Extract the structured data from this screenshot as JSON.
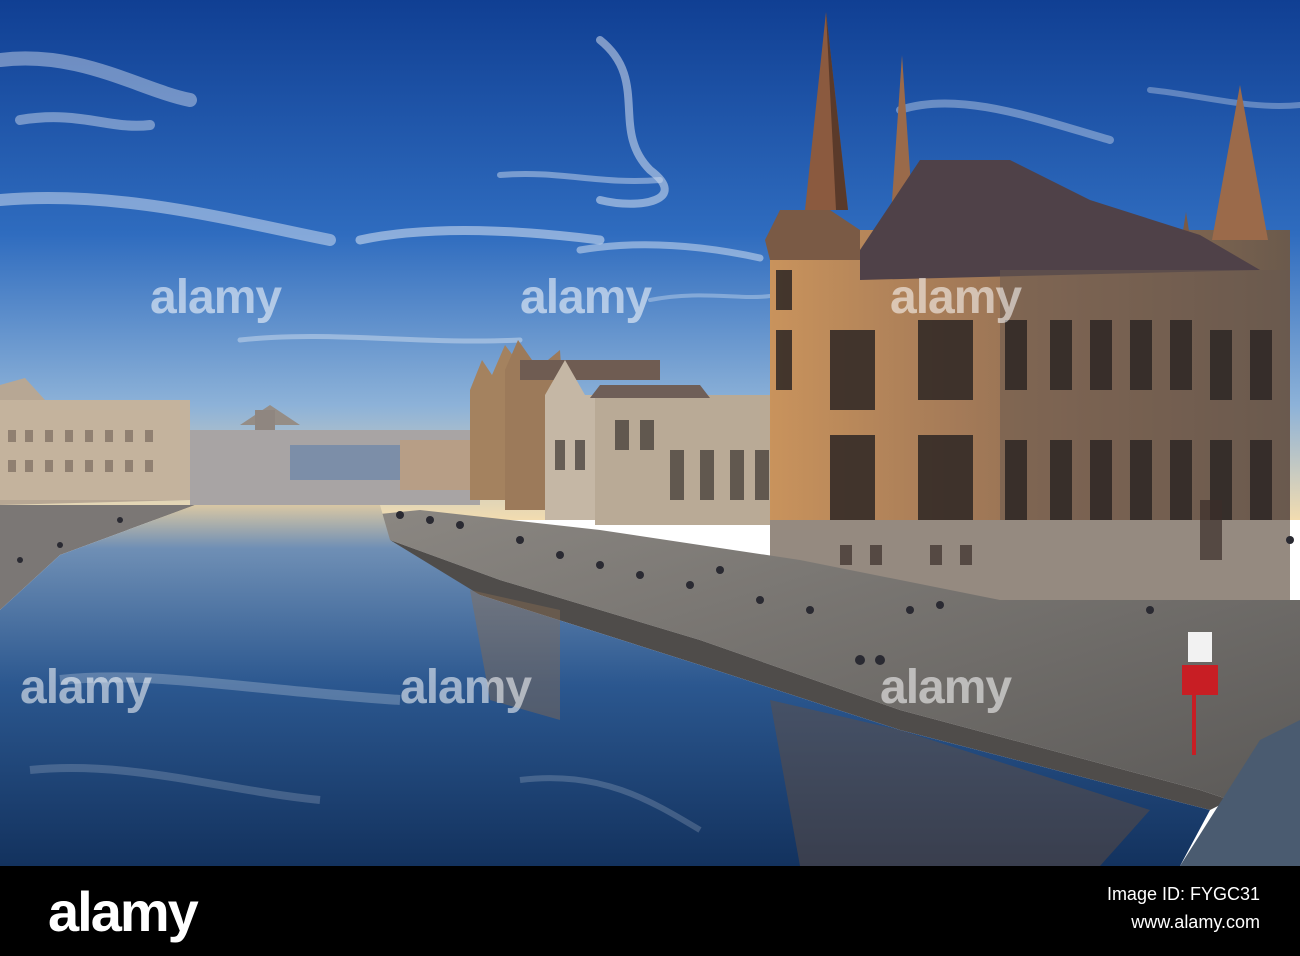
{
  "watermark": {
    "brand": "alamy"
  },
  "footer": {
    "logo": "alamy",
    "image_id_line": "Image ID: FYGC31",
    "site_line": "www.alamy.com"
  },
  "colors": {
    "sky_top": "#1a4fa0",
    "sky_bottom": "#8fb4d8",
    "horizon": "#f4d9a8",
    "stone_lit": "#b98a5f",
    "stone_shadow": "#5a4a3e",
    "water": "#274b7a",
    "quay": "#7d7a78",
    "footer_bg": "#000000"
  }
}
